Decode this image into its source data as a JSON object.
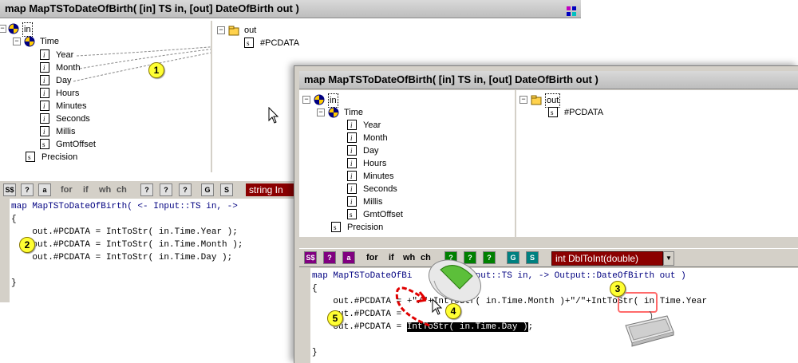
{
  "back_window": {
    "title": "map MapTSToDateOfBirth( [in] TS in, [out] DateOfBirth out )",
    "left_tree": {
      "root": "in",
      "group": "Time",
      "fields": [
        "Year",
        "Month",
        "Day",
        "Hours",
        "Minutes",
        "Seconds",
        "Millis",
        "GmtOffset"
      ],
      "extra": "Precision"
    },
    "right_tree": {
      "root": "out",
      "child": "#PCDATA"
    },
    "toolbar": {
      "b1": "S$",
      "b2": "?",
      "b3": "a",
      "for": "for",
      "if": "if",
      "wh": "wh",
      "ch": "ch",
      "b4": "?",
      "b5": "?",
      "b6": "?",
      "b7": "G",
      "b8": "S",
      "func": "string In"
    },
    "code": {
      "line1": "map MapTSToDateOfBirth( <- Input::TS in, ->",
      "line2": "{",
      "line3": "    out.#PCDATA = IntToStr( in.Time.Year );",
      "line4": "    out.#PCDATA = IntToStr( in.Time.Month );",
      "line5": "    out.#PCDATA = IntToStr( in.Time.Day );",
      "line6": "}"
    }
  },
  "front_window": {
    "title": "map MapTSToDateOfBirth( [in] TS in, [out] DateOfBirth out )",
    "left_tree": {
      "root": "in",
      "group": "Time",
      "fields": [
        "Year",
        "Month",
        "Day",
        "Hours",
        "Minutes",
        "Seconds",
        "Millis",
        "GmtOffset"
      ],
      "extra": "Precision"
    },
    "right_tree": {
      "root": "out",
      "child": "#PCDATA"
    },
    "toolbar": {
      "b1": "S$",
      "b2": "?",
      "b3": "a",
      "for": "for",
      "if": "if",
      "wh": "wh",
      "ch": "ch",
      "b4": "?",
      "b5": "?",
      "b6": "?",
      "b7": "G",
      "b8": "S",
      "func": "int DblToInt(double)"
    },
    "code": {
      "line1": "map MapTSToDateOfBi",
      "line1b": "Input::TS in, -> Output::DateOfBirth out )",
      "line2": "{",
      "line3a": "    out.#PCDATA = ",
      "line3b": "+\"/\"+IntToStr( in.Time.Month )",
      "line3c": "+\"/\"+",
      "line3d": "IntToStr( in.Time.Year",
      "line4": "    out.#PCDATA = ",
      "line5a": "    out.#PCDATA = ",
      "line5b": "IntToStr( in.Time.Day )",
      "line5c": ";",
      "line6": "}"
    }
  },
  "badges": [
    "1",
    "2",
    "3",
    "4",
    "5"
  ],
  "colors": {
    "badge": "#ffff33",
    "func_bg": "#8b0000",
    "callout": "#ff6a6a"
  }
}
